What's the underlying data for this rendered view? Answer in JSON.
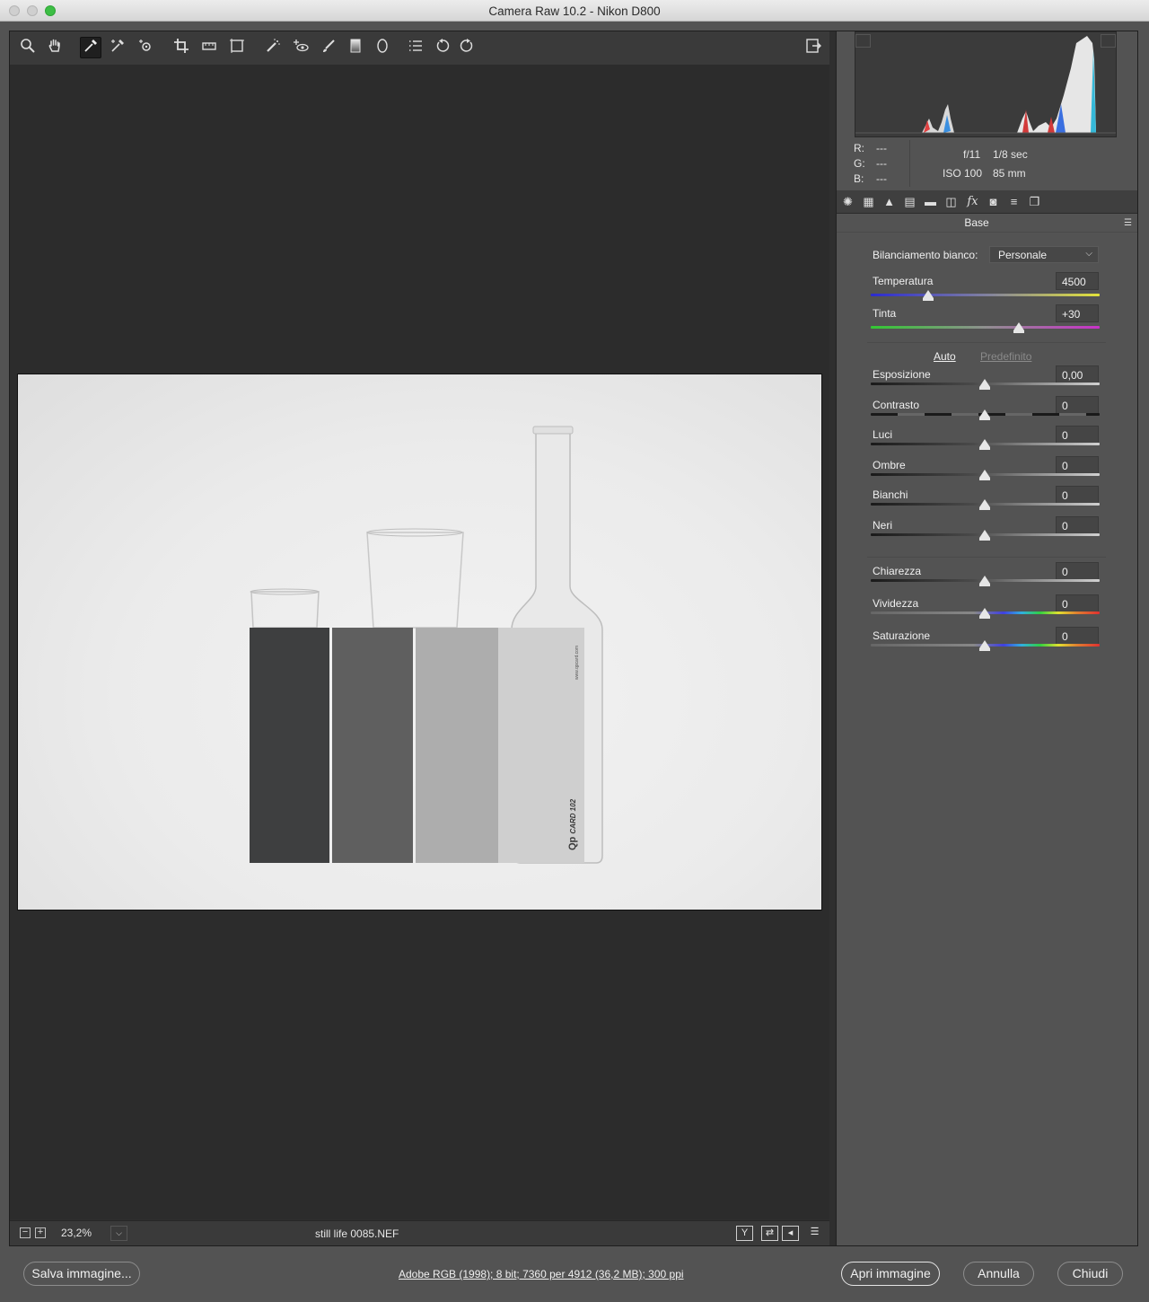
{
  "window": {
    "title": "Camera Raw 10.2  -  Nikon D800"
  },
  "toolbar": {
    "tools": [
      {
        "name": "zoom-tool",
        "icon": "magnifier-icon"
      },
      {
        "name": "hand-tool",
        "icon": "hand-icon"
      },
      {
        "name": "white-balance-tool",
        "icon": "eyedropper-icon",
        "active": true
      },
      {
        "name": "color-sampler-tool",
        "icon": "color-sampler-icon"
      },
      {
        "name": "targeted-adjustment-tool",
        "icon": "target-adjust-icon"
      },
      {
        "name": "crop-tool",
        "icon": "crop-icon"
      },
      {
        "name": "straighten-tool",
        "icon": "straighten-icon"
      },
      {
        "name": "transform-tool",
        "icon": "transform-icon"
      },
      {
        "name": "spot-removal-tool",
        "icon": "spot-removal-icon"
      },
      {
        "name": "red-eye-tool",
        "icon": "red-eye-icon"
      },
      {
        "name": "adjustment-brush-tool",
        "icon": "brush-icon"
      },
      {
        "name": "graduated-filter-tool",
        "icon": "graduated-filter-icon"
      },
      {
        "name": "radial-filter-tool",
        "icon": "radial-filter-icon"
      },
      {
        "name": "preferences-tool",
        "icon": "list-icon"
      },
      {
        "name": "rotate-left-tool",
        "icon": "rotate-ccw-icon"
      },
      {
        "name": "rotate-right-tool",
        "icon": "rotate-cw-icon"
      }
    ],
    "fullscreen_icon": "fullscreen-toggle-icon"
  },
  "histogram": {
    "rgb": {
      "r_label": "R:",
      "r_value": "---",
      "g_label": "G:",
      "g_value": "---",
      "b_label": "B:",
      "b_value": "---"
    },
    "exif": {
      "aperture": "f/11",
      "shutter": "1/8 sec",
      "iso": "ISO 100",
      "focal": "85 mm"
    }
  },
  "panel": {
    "title": "Base",
    "tabs": [
      "basic-tab-icon",
      "tone-curve-tab-icon",
      "detail-tab-icon",
      "hsl-tab-icon",
      "split-toning-tab-icon",
      "lens-corrections-tab-icon",
      "effects-tab-icon",
      "camera-calibration-tab-icon",
      "presets-tab-icon",
      "snapshots-tab-icon"
    ],
    "white_balance": {
      "label": "Bilanciamento bianco:",
      "value": "Personale"
    },
    "temperature": {
      "label": "Temperatura",
      "value": "4500",
      "position": 0.25
    },
    "tint": {
      "label": "Tinta",
      "value": "+30",
      "position": 0.65
    },
    "auto_label": "Auto",
    "default_label": "Predefinito",
    "sliders_tone": [
      {
        "key": "esposizione",
        "label": "Esposizione",
        "value": "0,00"
      },
      {
        "key": "contrasto",
        "label": "Contrasto",
        "value": "0"
      },
      {
        "key": "luci",
        "label": "Luci",
        "value": "0"
      },
      {
        "key": "ombre",
        "label": "Ombre",
        "value": "0"
      },
      {
        "key": "bianchi",
        "label": "Bianchi",
        "value": "0"
      },
      {
        "key": "neri",
        "label": "Neri",
        "value": "0"
      }
    ],
    "sliders_presence": [
      {
        "key": "chiarezza",
        "label": "Chiarezza",
        "value": "0"
      },
      {
        "key": "vividezza",
        "label": "Vividezza",
        "value": "0"
      },
      {
        "key": "saturazione",
        "label": "Saturazione",
        "value": "0"
      }
    ]
  },
  "statusbar": {
    "zoom": "23,2%",
    "filename": "still life 0085.NEF"
  },
  "photo": {
    "card_brand": "Qp",
    "card_model": "CARD 102",
    "card_url": "www.qpcard.com"
  },
  "footer": {
    "save_label": "Salva immagine...",
    "workflow_info": "Adobe RGB (1998); 8 bit; 7360 per 4912 (36,2 MB); 300 ppi",
    "open_label": "Apri immagine",
    "cancel_label": "Annulla",
    "close_label": "Chiudi"
  },
  "colors": {
    "panel_bg": "#535353",
    "canvas_bg": "#2c2c2c",
    "temp_gradient": [
      "#2b2bd0",
      "#e2e23a"
    ],
    "tint_gradient": [
      "#32c832",
      "#c832c8"
    ]
  }
}
